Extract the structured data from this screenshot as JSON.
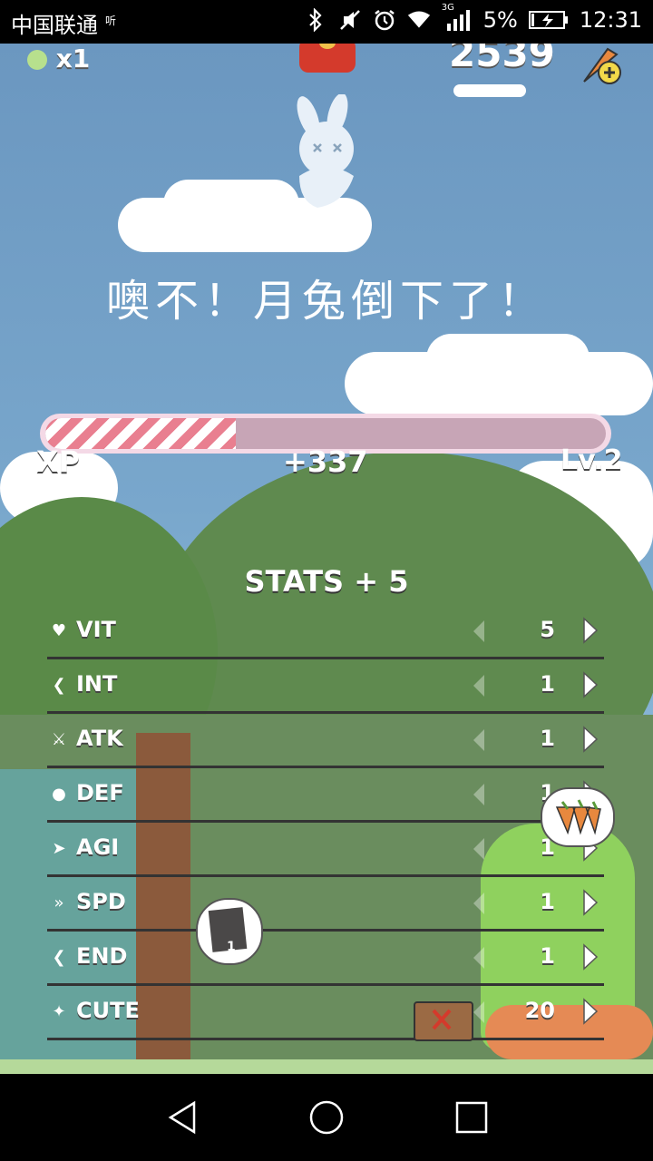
{
  "statusbar": {
    "carrier": "中国联通",
    "hd": "听",
    "network": "3G",
    "battery": "5%",
    "time": "12:31"
  },
  "hud": {
    "lives": "x1",
    "carrots": "2539"
  },
  "banner": {
    "text": "噢不！月兔倒下了！"
  },
  "xp": {
    "label": "XP",
    "gain": "+337",
    "level": "Lv.2",
    "progress": 0.34
  },
  "stats": {
    "title": "STATS + 5",
    "items": [
      {
        "name": "VIT",
        "value": "5",
        "icon": "heart-icon"
      },
      {
        "name": "INT",
        "value": "1",
        "icon": "brain-icon"
      },
      {
        "name": "ATK",
        "value": "1",
        "icon": "sword-icon"
      },
      {
        "name": "DEF",
        "value": "1",
        "icon": "shield-icon"
      },
      {
        "name": "AGI",
        "value": "1",
        "icon": "agility-icon"
      },
      {
        "name": "SPD",
        "value": "1",
        "icon": "speed-icon"
      },
      {
        "name": "END",
        "value": "1",
        "icon": "endurance-icon"
      },
      {
        "name": "CUTE",
        "value": "20",
        "icon": "sparkle-icon"
      }
    ]
  },
  "bubble": {
    "count": "1"
  },
  "colors": {
    "xp_fill": "#e97f90",
    "xp_track": "#c7a5b6",
    "accent_red": "#d43a2c"
  }
}
